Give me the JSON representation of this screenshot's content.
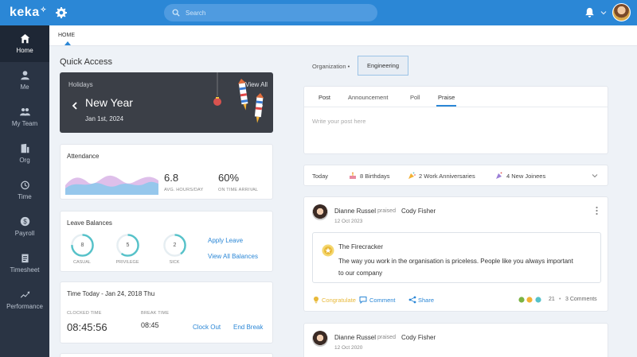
{
  "brand": {
    "logo_text": "keka"
  },
  "sidebar": {
    "items": [
      {
        "label": "Home",
        "icon": "home-icon",
        "active": true
      },
      {
        "label": "Me",
        "icon": "person-icon"
      },
      {
        "label": "My Team",
        "icon": "team-icon"
      },
      {
        "label": "Org",
        "icon": "building-icon"
      },
      {
        "label": "Time",
        "icon": "clock-icon"
      },
      {
        "label": "Payroll",
        "icon": "dollar-icon"
      },
      {
        "label": "Timesheet",
        "icon": "clipboard-icon"
      },
      {
        "label": "Performance",
        "icon": "trend-icon"
      }
    ]
  },
  "topbar": {
    "search_placeholder": "Search"
  },
  "breadcrumb": {
    "current": "HOME"
  },
  "quick_access": {
    "title": "Quick Access",
    "holidays": {
      "label": "Holidays",
      "view_all": "View All",
      "name": "New Year",
      "date": "Jan 1st, 2024"
    },
    "attendance": {
      "title": "Attendance",
      "avg_hours": "6.8",
      "avg_hours_label": "AVG. HOURS/DAY",
      "on_time": "60%",
      "on_time_label": "ON TIME ARRIVAL"
    },
    "leave": {
      "title": "Leave Balances",
      "balances": [
        {
          "value": "8",
          "label": "CASUAL",
          "fraction": 0.75
        },
        {
          "value": "5",
          "label": "PRIVILEGE",
          "fraction": 0.6
        },
        {
          "value": "2",
          "label": "SICK",
          "fraction": 0.4
        }
      ],
      "apply": "Apply Leave",
      "view_all": "View All Balances"
    },
    "time_today": {
      "title": "Time Today - Jan 24, 2018 Thu",
      "clocked_label": "CLOCKED TIME",
      "clocked_value": "08:45:56",
      "break_label": "BREAK TIME",
      "break_value": "08:45",
      "clock_out": "Clock Out",
      "end_break": "End Break"
    }
  },
  "org_tabs": {
    "organization": "Organization",
    "engineering": "Engineering"
  },
  "composer": {
    "tabs": [
      "Post",
      "Announcement",
      "Poll",
      "Praise"
    ],
    "placeholder": "Write your post here"
  },
  "today": {
    "label": "Today",
    "birthdays_count": "8",
    "birthdays_label": "Birthdays",
    "anniversaries_count": "2",
    "anniversaries_label": "Work Anniversaries",
    "joinees_count": "4",
    "joinees_label": "New Joinees"
  },
  "posts": [
    {
      "author": "Dianne Russel",
      "verb": "praised",
      "target": "Cody Fisher",
      "date": "12 Oct 2023",
      "badge_title": "The Firecracker",
      "message": "The way you work in the organisation is priceless. People like you always important to our company",
      "like_label": "Congratulate",
      "comment_label": "Comment",
      "share_label": "Share",
      "reactions_count": "21",
      "comments": "3 Comments"
    },
    {
      "author": "Dianne Russel",
      "verb": "praised",
      "target": "Cody Fisher",
      "date": "12 Oct 2020"
    }
  ],
  "colors": {
    "brand_blue": "#2b87d6",
    "sidebar": "#2a3444",
    "accent_teal": "#56c2c9",
    "praise_gold": "#e8b93a"
  }
}
